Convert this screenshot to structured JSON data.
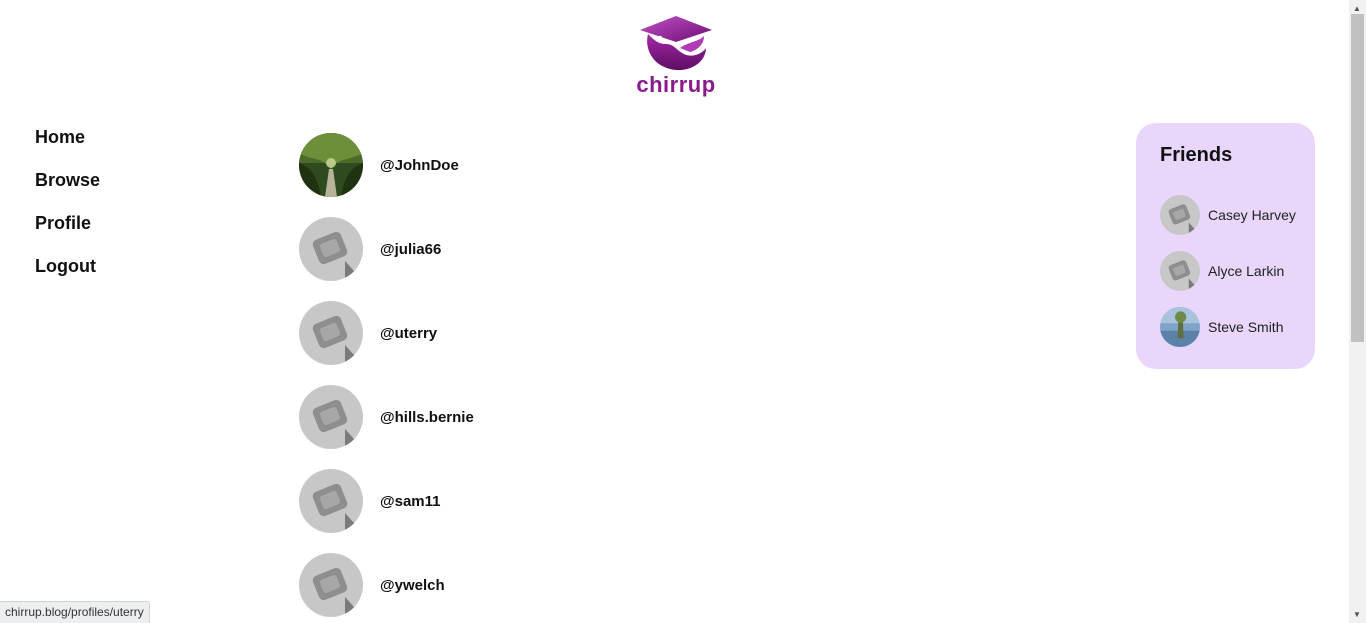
{
  "brand": {
    "name": "chirrup",
    "color": "#8a1b8e"
  },
  "nav": {
    "items": [
      {
        "label": "Home"
      },
      {
        "label": "Browse"
      },
      {
        "label": "Profile"
      },
      {
        "label": "Logout"
      }
    ]
  },
  "users": [
    {
      "handle": "@JohnDoe",
      "avatar": "photo-trees"
    },
    {
      "handle": "@julia66",
      "avatar": "default"
    },
    {
      "handle": "@uterry",
      "avatar": "default"
    },
    {
      "handle": "@hills.bernie",
      "avatar": "default"
    },
    {
      "handle": "@sam11",
      "avatar": "default"
    },
    {
      "handle": "@ywelch",
      "avatar": "default"
    }
  ],
  "friends": {
    "title": "Friends",
    "card_color": "#e8d6fb",
    "items": [
      {
        "name": "Casey Harvey",
        "avatar": "default"
      },
      {
        "name": "Alyce Larkin",
        "avatar": "default"
      },
      {
        "name": "Steve Smith",
        "avatar": "photo-lake"
      }
    ]
  },
  "status_bar": {
    "url": "chirrup.blog/profiles/uterry"
  }
}
